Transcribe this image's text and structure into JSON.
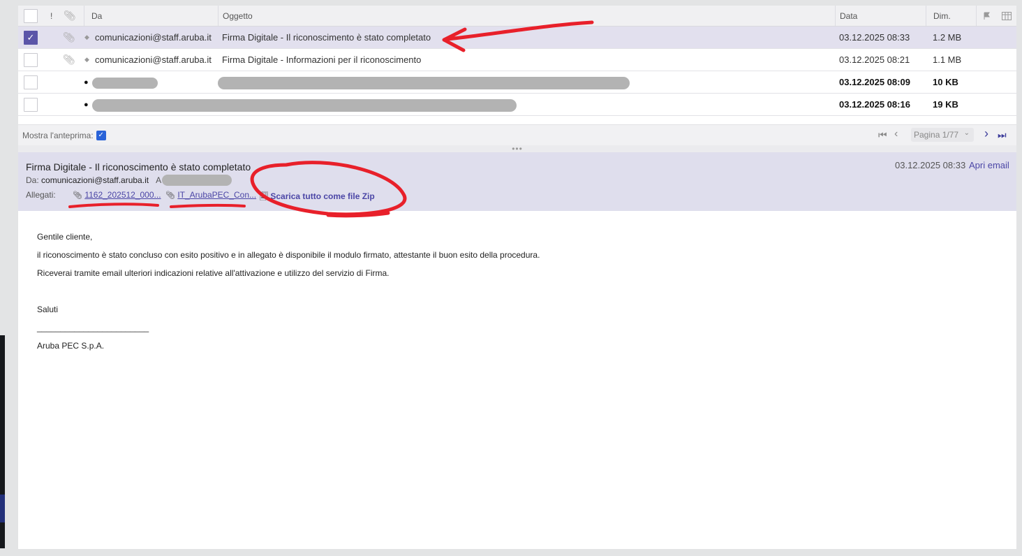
{
  "list": {
    "columns": {
      "flag": "!",
      "from": "Da",
      "subject": "Oggetto",
      "date": "Data",
      "size": "Dim."
    },
    "rows": [
      {
        "from": "comunicazioni@staff.aruba.it",
        "subject": "Firma Digitale - Il riconoscimento è stato completato",
        "date": "03.12.2025 08:33",
        "size": "1.2 MB"
      },
      {
        "from": "comunicazioni@staff.aruba.it",
        "subject": "Firma Digitale - Informazioni per il riconoscimento",
        "date": "03.12.2025 08:21",
        "size": "1.1 MB"
      },
      {
        "from": "",
        "subject": "",
        "date": "03.12.2025 08:09",
        "size": "10 KB"
      },
      {
        "from": "",
        "subject": "",
        "date": "03.12.2025 08:16",
        "size": "19 KB"
      }
    ],
    "footer": {
      "preview_label": "Mostra l'anteprima:",
      "page": "Pagina 1/77"
    }
  },
  "preview": {
    "subject": "Firma Digitale - Il riconoscimento è stato completato",
    "date": "03.12.2025 08:33",
    "open_link": "Apri email",
    "from_label": "Da:",
    "from": "comunicazioni@staff.aruba.it",
    "to_label": "A",
    "attachments_label": "Allegati:",
    "attachments": [
      "1162_202512_000...",
      "IT_ArubaPEC_Con..."
    ],
    "zip_label": "Scarica tutto come file Zip"
  },
  "body": {
    "greeting": "Gentile cliente,",
    "line1": "il riconoscimento è stato concluso con esito positivo e in allegato è disponibile il modulo firmato, attestante il buon esito della procedura.",
    "line2": "Riceverai tramite email ulteriori indicazioni relative all'attivazione e utilizzo del servizio di Firma.",
    "closing": "Saluti",
    "divider": "________________________",
    "signature": "Aruba PEC S.p.A."
  },
  "colors": {
    "accent": "#4b46a6",
    "selected_row": "#e2e0ee",
    "preview_header": "#dfdeed",
    "annotation": "#e8202a"
  }
}
